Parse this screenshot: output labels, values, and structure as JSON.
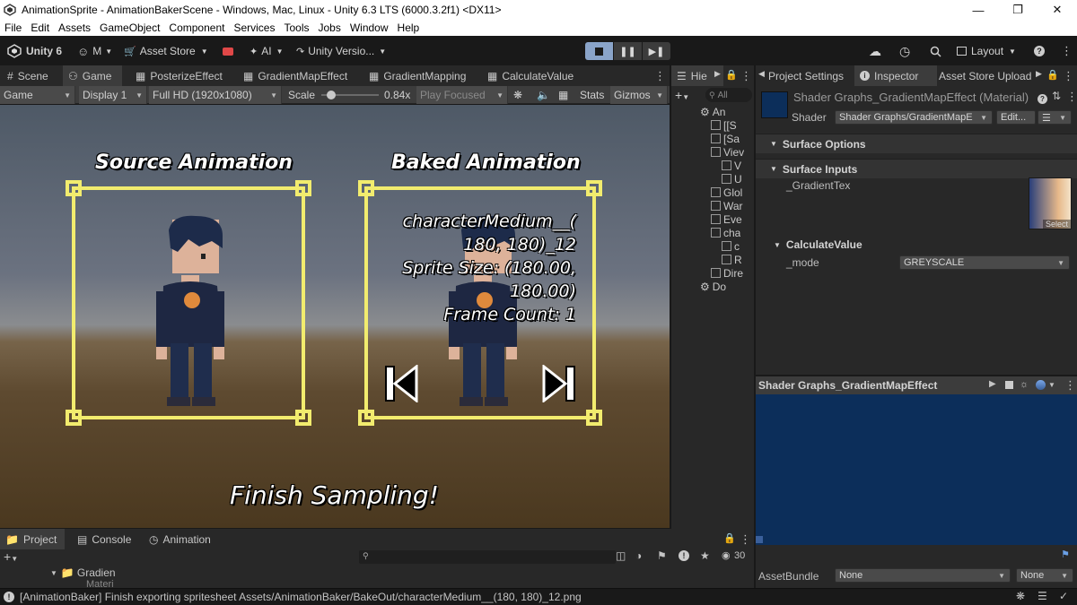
{
  "window": {
    "title": "AnimationSprite - AnimationBakerScene - Windows, Mac, Linux - Unity 6.3 LTS (6000.3.2f1) <DX11>"
  },
  "menu": [
    "File",
    "Edit",
    "Assets",
    "GameObject",
    "Component",
    "Services",
    "Tools",
    "Jobs",
    "Window",
    "Help"
  ],
  "toolbar": {
    "unity_label": "Unity 6",
    "account_label": "M",
    "asset_store_label": "Asset Store",
    "ai_label": "AI",
    "version_control_label": "Unity Versio...",
    "layout_label": "Layout"
  },
  "scene_tabs": [
    "Scene",
    "Game",
    "PosterizeEffect",
    "GradientMapEffect",
    "GradientMapping",
    "CalculateValue"
  ],
  "game_bar": {
    "view_mode": "Game",
    "display": "Display 1",
    "resolution": "Full HD (1920x1080)",
    "scale_label": "Scale",
    "scale_value": "0.84x",
    "scale_fraction": 0.12,
    "play_mode": "Play Focused",
    "stats_label": "Stats",
    "gizmos_label": "Gizmos"
  },
  "game_view": {
    "source_title": "Source Animation",
    "baked_title": "Baked Animation",
    "info_line1": "characterMedium__(",
    "info_line2": "180, 180)_12",
    "info_line3": "Sprite Size: (180.00,",
    "info_line4": "180.00)",
    "info_line5": "Frame Count: 1",
    "finish_text": "Finish Sampling!"
  },
  "hierarchy": {
    "tab_label": "Hie",
    "search_placeholder": "All",
    "rows": [
      {
        "label": "An",
        "depth": 0,
        "kind": "scene"
      },
      {
        "label": "[[S",
        "depth": 1,
        "kind": "object"
      },
      {
        "label": "[Sa",
        "depth": 1,
        "kind": "object"
      },
      {
        "label": "Viev",
        "depth": 1,
        "kind": "object"
      },
      {
        "label": "V",
        "depth": 2,
        "kind": "object"
      },
      {
        "label": "U",
        "depth": 2,
        "kind": "object"
      },
      {
        "label": "Glol",
        "depth": 1,
        "kind": "object"
      },
      {
        "label": "War",
        "depth": 1,
        "kind": "object"
      },
      {
        "label": "Eve",
        "depth": 1,
        "kind": "object"
      },
      {
        "label": "cha",
        "depth": 1,
        "kind": "object"
      },
      {
        "label": "c",
        "depth": 2,
        "kind": "object"
      },
      {
        "label": "R",
        "depth": 2,
        "kind": "object"
      },
      {
        "label": "Dire",
        "depth": 1,
        "kind": "object"
      },
      {
        "label": "Do",
        "depth": 0,
        "kind": "scene"
      }
    ]
  },
  "inspector_tabs": [
    "Project Settings",
    "Inspector",
    "Asset Store Upload"
  ],
  "inspector": {
    "material_name": "Shader Graphs_GradientMapEffect (Material)",
    "shader_label": "Shader",
    "shader_value": "Shader Graphs/GradientMapE",
    "edit_label": "Edit...",
    "surface_options": "Surface Options",
    "surface_inputs": "Surface Inputs",
    "gradient_tex_label": "_GradientTex",
    "select_label": "Select",
    "calculate_value": "CalculateValue",
    "mode_label": "_mode",
    "mode_value": "GREYSCALE"
  },
  "preview": {
    "title": "Shader Graphs_GradientMapEffect"
  },
  "bottom_tabs": [
    "Project",
    "Console",
    "Animation"
  ],
  "project": {
    "folder1": "Gradien",
    "folder2": "Materi",
    "count": "30"
  },
  "asset_bundle": {
    "label": "AssetBundle",
    "value1": "None",
    "value2": "None"
  },
  "status": {
    "message": "[AnimationBaker] Finish exporting spritesheet Assets/AnimationBaker/BakeOut/characterMedium__(180, 180)_12.png"
  },
  "colors": {
    "frame_yellow": "#f2ec6e",
    "preview_blue": "#0c2e5a",
    "play_pressed": "#8aa4c9"
  }
}
